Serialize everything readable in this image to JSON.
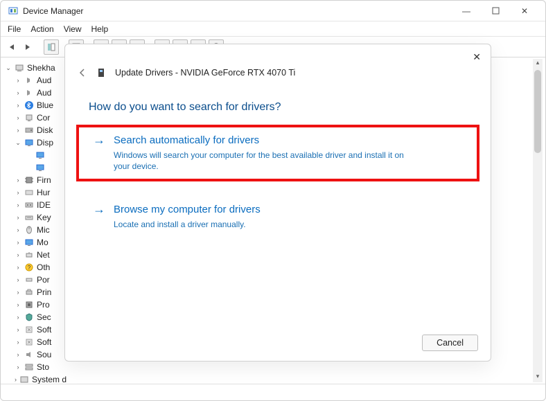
{
  "window": {
    "title": "Device Manager",
    "menu": [
      "File",
      "Action",
      "View",
      "Help"
    ]
  },
  "tree": {
    "root": "Shekha",
    "items": [
      {
        "label": "Aud",
        "twist": ">"
      },
      {
        "label": "Aud",
        "twist": ">"
      },
      {
        "label": "Blue",
        "twist": ">",
        "icon": "bt"
      },
      {
        "label": "Cor",
        "twist": ">",
        "icon": "pc"
      },
      {
        "label": "Disk",
        "twist": ">",
        "icon": "disk"
      },
      {
        "label": "Disp",
        "twist": "v",
        "icon": "mon"
      },
      {
        "label": "Firn",
        "twist": ">",
        "icon": "chip"
      },
      {
        "label": "Hur",
        "twist": ">",
        "icon": "hid"
      },
      {
        "label": "IDE",
        "twist": ">",
        "icon": "ide"
      },
      {
        "label": "Key",
        "twist": ">",
        "icon": "kb"
      },
      {
        "label": "Mic",
        "twist": ">",
        "icon": "mouse"
      },
      {
        "label": "Mo",
        "twist": ">",
        "icon": "mon"
      },
      {
        "label": "Net",
        "twist": ">",
        "icon": "net"
      },
      {
        "label": "Oth",
        "twist": ">",
        "icon": "unk"
      },
      {
        "label": "Por",
        "twist": ">",
        "icon": "port"
      },
      {
        "label": "Prin",
        "twist": ">",
        "icon": "print"
      },
      {
        "label": "Pro",
        "twist": ">",
        "icon": "cpu"
      },
      {
        "label": "Sec",
        "twist": ">",
        "icon": "sec"
      },
      {
        "label": "Soft",
        "twist": ">",
        "icon": "sw"
      },
      {
        "label": "Soft",
        "twist": ">",
        "icon": "sw"
      },
      {
        "label": "Sou",
        "twist": ">",
        "icon": "snd"
      },
      {
        "label": "Sto",
        "twist": ">",
        "icon": "sto"
      },
      {
        "label": "System devices",
        "twist": ">",
        "icon": "sys"
      }
    ]
  },
  "dialog": {
    "title": "Update Drivers - NVIDIA GeForce RTX 4070 Ti",
    "question": "How do you want to search for drivers?",
    "option1": {
      "title": "Search automatically for drivers",
      "desc": "Windows will search your computer for the best available driver and install it on your device."
    },
    "option2": {
      "title": "Browse my computer for drivers",
      "desc": "Locate and install a driver manually."
    },
    "cancel": "Cancel"
  }
}
